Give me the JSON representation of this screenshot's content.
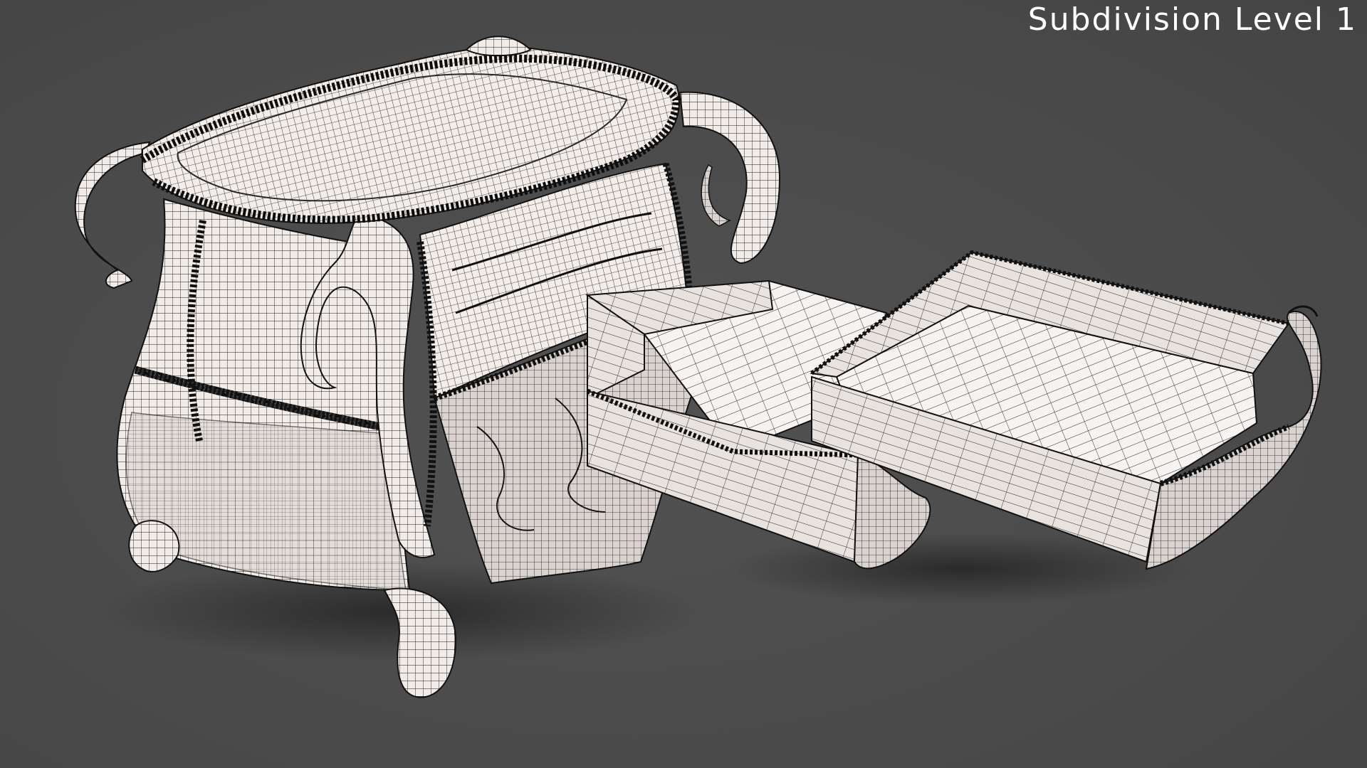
{
  "viewport": {
    "overlay_label": "Subdivision Level 1"
  },
  "colors": {
    "background": "#4a4a4a",
    "model_fill": "#f3eeeb",
    "wire": "#1a1a1a",
    "trim_beads": "#141414"
  }
}
